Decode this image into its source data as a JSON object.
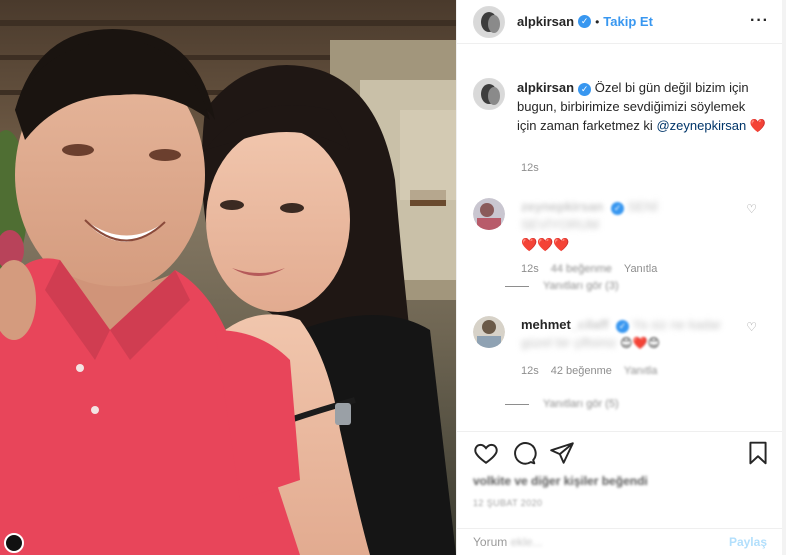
{
  "header": {
    "username": "alpkirsan",
    "separator": "•",
    "follow_label": "Takip Et",
    "more_icon": "more-horizontal-icon"
  },
  "caption": {
    "username": "alpkirsan",
    "text": "Özel bi gün değil bizim için bugun, birbirimize sevdiğimizi söylemek için zaman farketmez ki",
    "mention": "@zeynepkirsan",
    "emoji": "❤️",
    "time": "12s"
  },
  "comments": [
    {
      "username": "zeynepkirsan",
      "text_blurred": "SENİ SEVİYORUM",
      "emoji": "❤️❤️❤️",
      "time": "12s",
      "likes": "44 beğenme",
      "reply": "Yanıtla",
      "view_replies": "Yanıtları gör (3)"
    },
    {
      "username_visible": "mehmet",
      "username_blurred": "_cilaff",
      "text_blurred": "Ya siz ne kadar güzel bir çiftsiniz",
      "emoji": "😊❤️😊",
      "time": "12s",
      "likes": "42 beğenme",
      "reply": "Yanıtla",
      "view_replies": "Yanıtları gör (5)"
    }
  ],
  "likes": {
    "text": "volkite ve diğer kişiler beğendi"
  },
  "date": "12 ŞUBAT 2020",
  "comment_box": {
    "placeholder_visible": "Yorum",
    "placeholder_blurred": "ekle...",
    "share_label": "Paylaş"
  },
  "colors": {
    "accent": "#3897f0",
    "heart": "#ed4956",
    "shirt": "#e8455a"
  }
}
